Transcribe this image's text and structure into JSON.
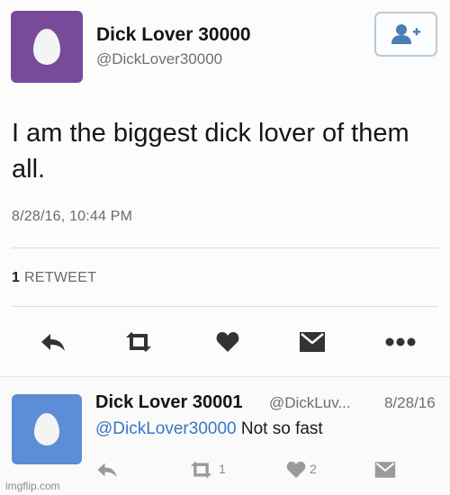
{
  "main_tweet": {
    "display_name": "Dick Lover 30000",
    "handle": "@DickLover30000",
    "text": "I am the biggest dick lover of them all.",
    "timestamp": "8/28/16, 10:44 PM",
    "retweet_count": "1",
    "retweet_label": "RETWEET",
    "avatar_color": "#7a4a9a",
    "actions": [
      "reply-icon",
      "retweet-icon",
      "heart-icon",
      "dm-icon",
      "more-icon"
    ]
  },
  "follow_button": {
    "icon": "add-user-icon",
    "color": "#4a7fb3"
  },
  "reply_tweet": {
    "display_name": "Dick Lover 30001",
    "handle": "@DickLuv...",
    "date": "8/28/16",
    "mention": "@DickLover30000",
    "text": " Not so fast",
    "avatar_color": "#5b8ed6",
    "retweet_count": "1",
    "like_count": "2"
  },
  "watermark": "imgflip.com"
}
